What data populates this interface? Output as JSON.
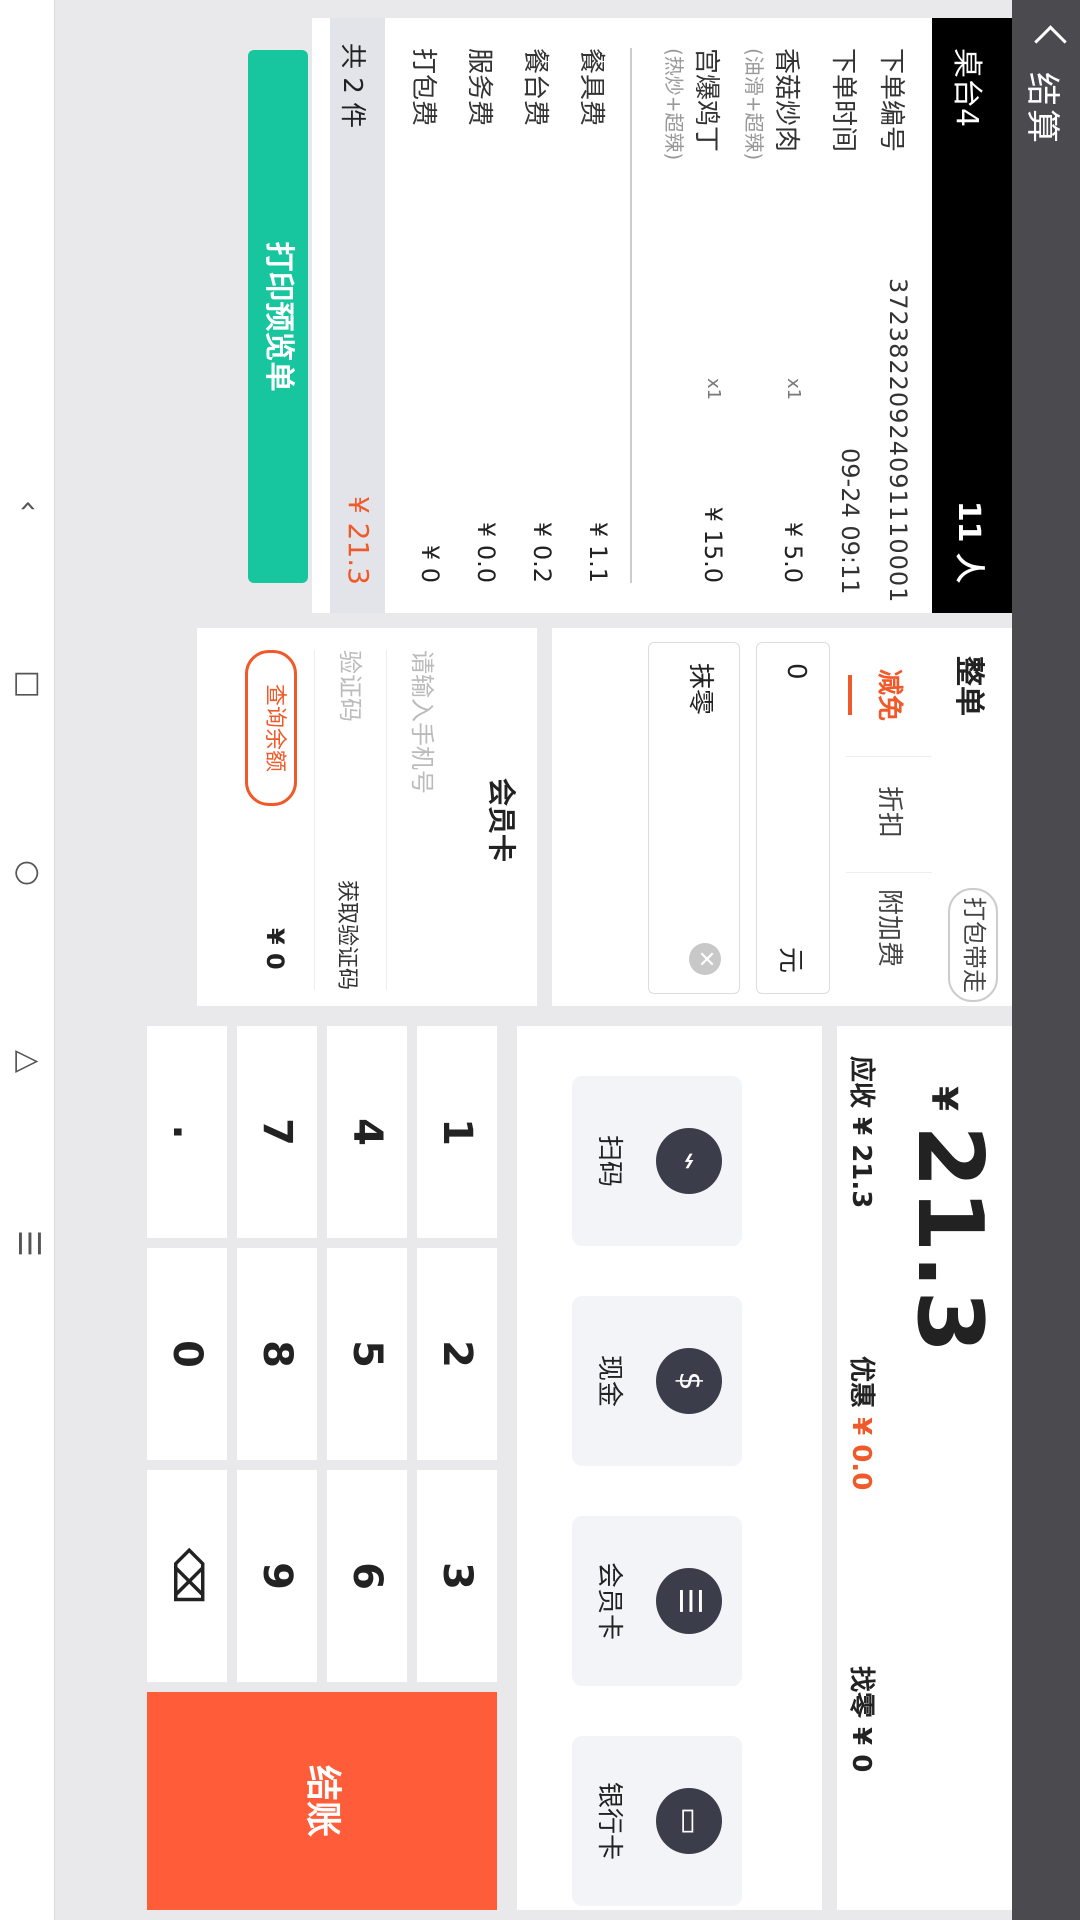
{
  "header": {
    "title": "结算"
  },
  "order": {
    "table": "桌台4",
    "people": "11 人",
    "order_no_label": "下单编号",
    "order_no": "37238220924091110001",
    "order_time_label": "下单时间",
    "order_time": "09-24 09:11",
    "items": [
      {
        "name": "香菇炒肉",
        "note": "(油滑+超辣)",
        "qty": "x1",
        "price": "¥ 5.0"
      },
      {
        "name": "宫爆鸡丁",
        "note": "(热炒+超辣)",
        "qty": "x1",
        "price": "¥ 15.0"
      }
    ],
    "fees": [
      {
        "name": "餐具费",
        "price": "¥ 1.1"
      },
      {
        "name": "餐台费",
        "price": "¥ 0.2"
      },
      {
        "name": "服务费",
        "price": "¥ 0.0"
      },
      {
        "name": "打包费",
        "price": "¥ 0"
      }
    ],
    "count": "共 2 件",
    "total": "¥ 21.3",
    "print_btn": "打印预览单"
  },
  "discount": {
    "title": "整单",
    "takeaway": "打包带走",
    "tabs": [
      "减免",
      "折扣",
      "附加费"
    ],
    "value": "0",
    "unit": "元",
    "round_off": "抹零"
  },
  "member": {
    "title": "会员卡",
    "phone_placeholder": "请输入手机号",
    "code_placeholder": "验证码",
    "get_code": "获取验证码",
    "query_btn": "查询余额",
    "amount": "¥ 0"
  },
  "summary": {
    "currency": "¥",
    "amount": "21.3",
    "receivable": "应收 ¥ 21.3",
    "discount_label": "优惠",
    "discount_value": "¥ 0.0",
    "change": "找零 ¥ 0"
  },
  "payments": [
    {
      "label": "扫码",
      "icon": "scanner-icon"
    },
    {
      "label": "现金",
      "icon": "cash-icon"
    },
    {
      "label": "会员卡",
      "icon": "member-card-icon"
    },
    {
      "label": "银行卡",
      "icon": "bank-card-icon"
    }
  ],
  "keypad": {
    "keys": [
      "1",
      "2",
      "3",
      "4",
      "5",
      "6",
      "7",
      "8",
      "9",
      ".",
      "0",
      "⌫"
    ],
    "checkout": "结账"
  }
}
